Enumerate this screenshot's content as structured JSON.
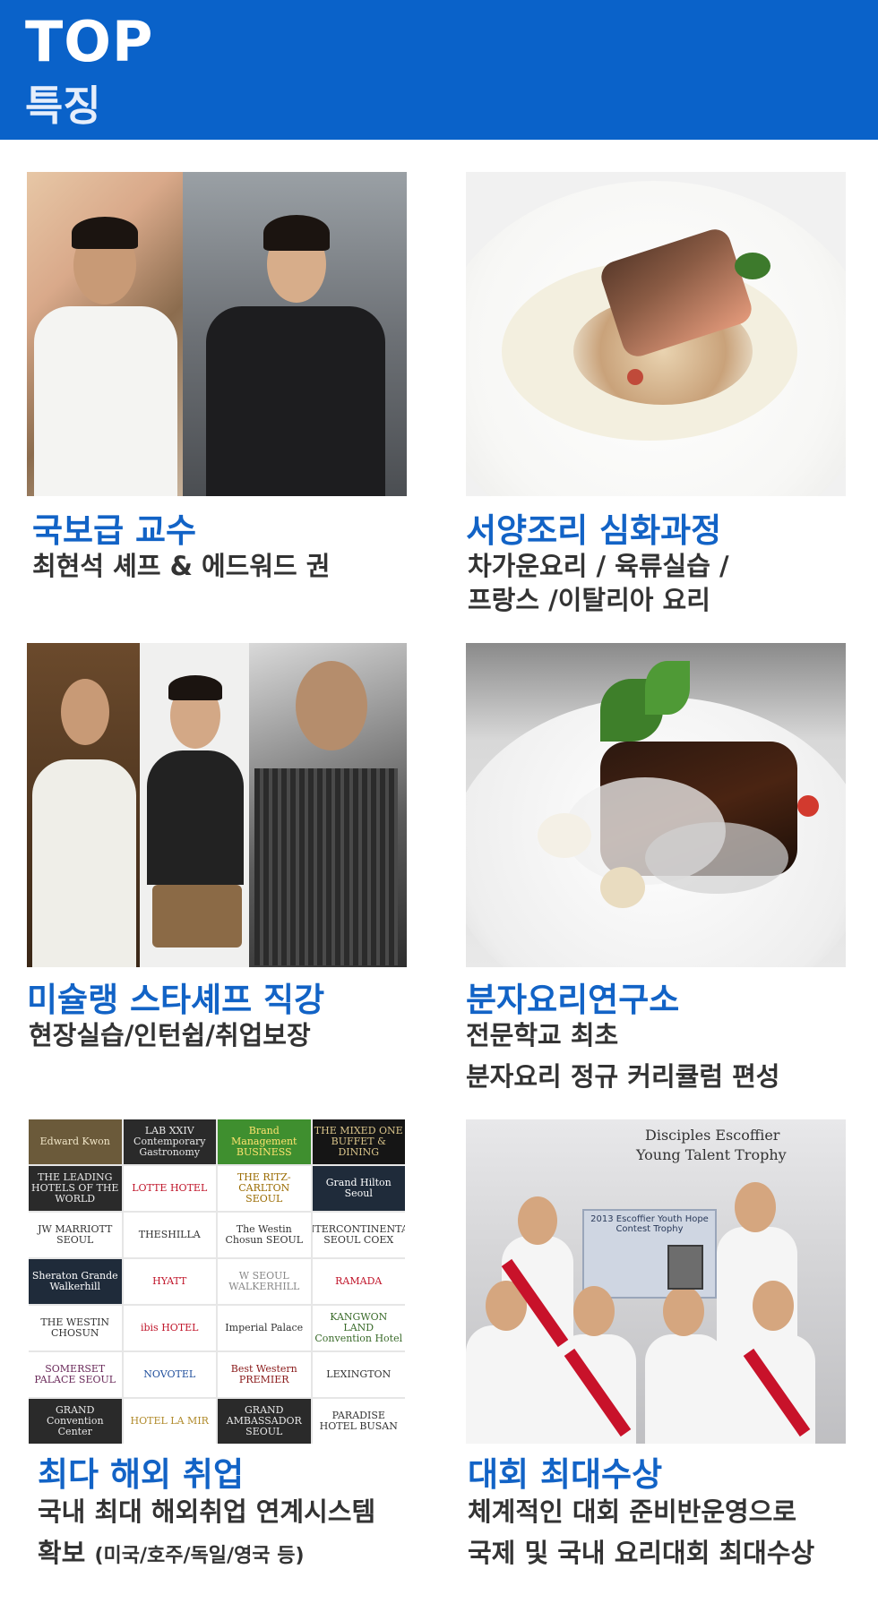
{
  "header": {
    "line1": "TOP",
    "line2": "특징"
  },
  "cards": [
    {
      "title": "국보급 교수",
      "desc": [
        "최현석 셰프 & 에드워드 권"
      ]
    },
    {
      "title": "서양조리  심화과정",
      "desc": [
        "차가운요리  /  육류실습  /",
        "프랑스  /이탈리아  요리"
      ]
    },
    {
      "title": "미슐랭 스타셰프 직강",
      "desc": [
        "현장실습/인턴쉽/취업보장"
      ]
    },
    {
      "title": "분자요리연구소",
      "desc": [
        "전문학교 최초",
        "분자요리 정규 커리큘럼 편성"
      ]
    },
    {
      "title": "최다 해외 취업",
      "desc": [
        "국내 최대 해외취업 연계시스템"
      ],
      "desc2_main": "확보 ",
      "desc2_small": "(미국/호주/독일/영국 등)"
    },
    {
      "title": "대회 최대수상",
      "desc": [
        "체계적인 대회 준비반운영으로",
        "국제 및 국내 요리대회 최대수상"
      ]
    }
  ],
  "logos": [
    "Edward Kwon",
    "LAB XXIV Contemporary Gastronomy",
    "Brand Management BUSINESS",
    "THE MIXED ONE BUFFET & DINING",
    "THE LEADING HOTELS OF THE WORLD",
    "LOTTE HOTEL",
    "THE RITZ-CARLTON SEOUL",
    "Grand Hilton Seoul",
    "JW MARRIOTT SEOUL",
    "THESHILLA",
    "The Westin Chosun SEOUL",
    "INTERCONTINENTAL SEOUL COEX",
    "Sheraton Grande Walkerhill",
    "HYATT",
    "W SEOUL WALKERHILL",
    "RAMADA",
    "THE WESTIN CHOSUN",
    "ibis HOTEL",
    "Imperial Palace",
    "KANGWON LAND Convention Hotel",
    "SOMERSET PALACE SEOUL",
    "NOVOTEL",
    "Best Western PREMIER",
    "LEXINGTON",
    "GRAND Convention Center",
    "HOTEL LA MIR",
    "GRAND AMBASSADOR SEOUL",
    "PARADISE HOTEL BUSAN"
  ],
  "trophy_photo": {
    "sign1": "Disciples Escoffier",
    "sign2": "Young Talent Trophy",
    "banner": "2013 Escoffier Youth Hope Contest Trophy"
  }
}
